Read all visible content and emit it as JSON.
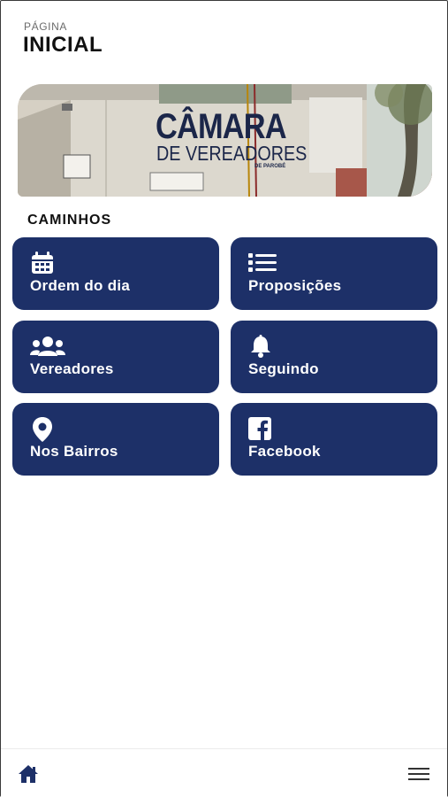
{
  "header": {
    "eyebrow": "PÁGINA",
    "title": "INICIAL"
  },
  "banner": {
    "logo_line1": "CÂMARA",
    "logo_line2": "DE VEREADORES",
    "logo_line3": "DE PAROBÉ"
  },
  "section": {
    "title": "CAMINHOS"
  },
  "tiles": [
    {
      "label": "Ordem do dia",
      "icon": "calendar-icon"
    },
    {
      "label": "Proposições",
      "icon": "list-icon"
    },
    {
      "label": "Vereadores",
      "icon": "users-icon"
    },
    {
      "label": "Seguindo",
      "icon": "bell-icon"
    },
    {
      "label": "Nos Bairros",
      "icon": "map-pin-icon"
    },
    {
      "label": "Facebook",
      "icon": "facebook-icon"
    }
  ],
  "bottom_nav": {
    "home_icon": "home-icon",
    "menu_icon": "hamburger-menu-icon"
  },
  "colors": {
    "tile_bg": "#1d3068",
    "home_icon": "#1d3068",
    "text": "#111111"
  }
}
